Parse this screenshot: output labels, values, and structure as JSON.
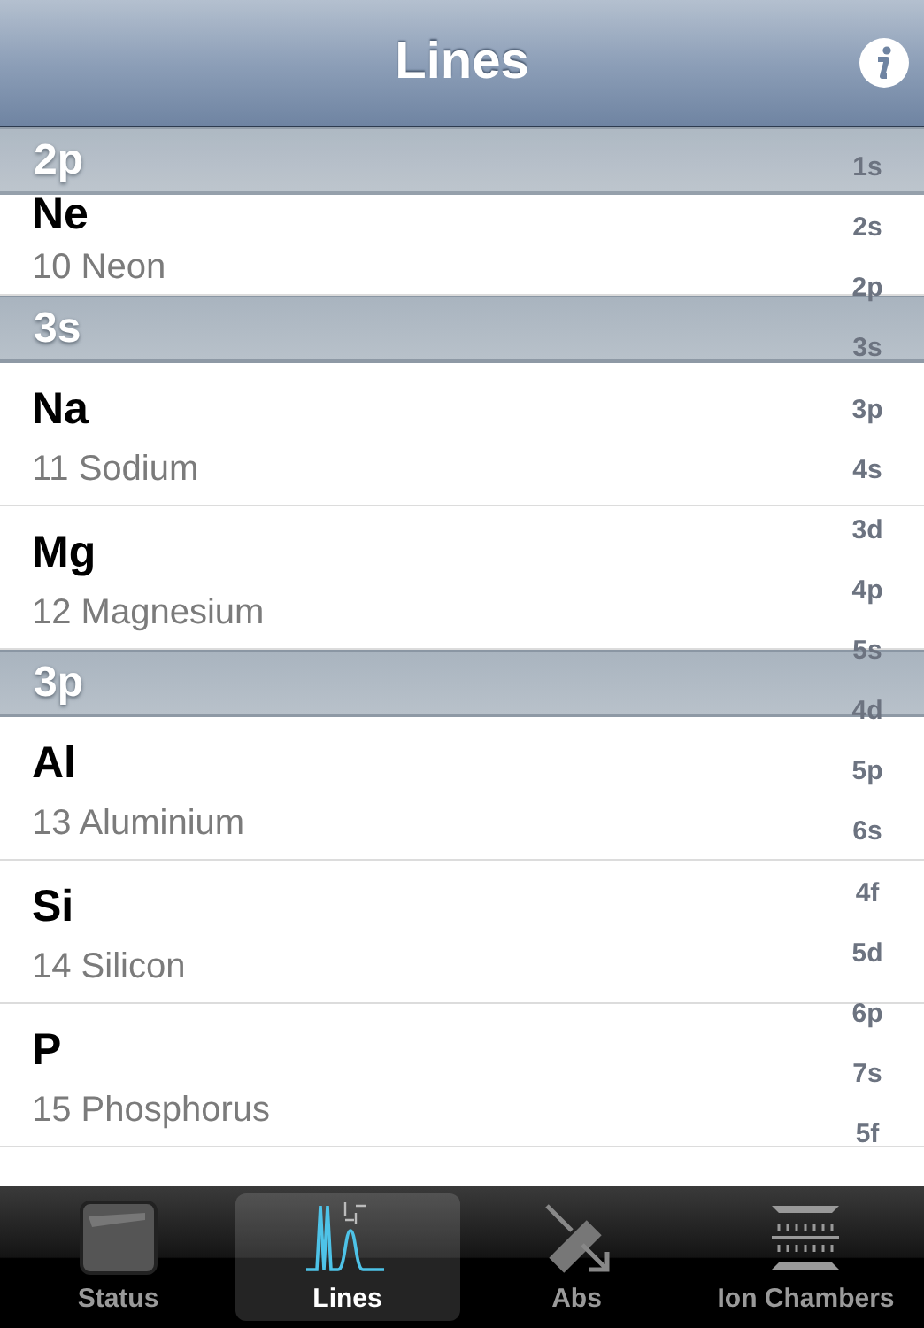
{
  "nav": {
    "title": "Lines"
  },
  "sections": [
    {
      "header": "2p",
      "rows": [
        {
          "symbol": "Ne",
          "name": "10 Neon"
        }
      ]
    },
    {
      "header": "3s",
      "rows": [
        {
          "symbol": "Na",
          "name": "11 Sodium"
        },
        {
          "symbol": "Mg",
          "name": "12 Magnesium"
        }
      ]
    },
    {
      "header": "3p",
      "rows": [
        {
          "symbol": "Al",
          "name": "13 Aluminium"
        },
        {
          "symbol": "Si",
          "name": "14 Silicon"
        },
        {
          "symbol": "P",
          "name": "15 Phosphorus"
        }
      ]
    }
  ],
  "index": [
    "1s",
    "2s",
    "2p",
    "3s",
    "3p",
    "4s",
    "3d",
    "4p",
    "5s",
    "4d",
    "5p",
    "6s",
    "4f",
    "5d",
    "6p",
    "7s",
    "5f"
  ],
  "tabs": [
    {
      "label": "Status",
      "kind": "status",
      "selected": false
    },
    {
      "label": "Lines",
      "kind": "lines",
      "selected": true
    },
    {
      "label": "Abs",
      "kind": "abs",
      "selected": false
    },
    {
      "label": "Ion Chambers",
      "kind": "chambers",
      "selected": false
    }
  ]
}
